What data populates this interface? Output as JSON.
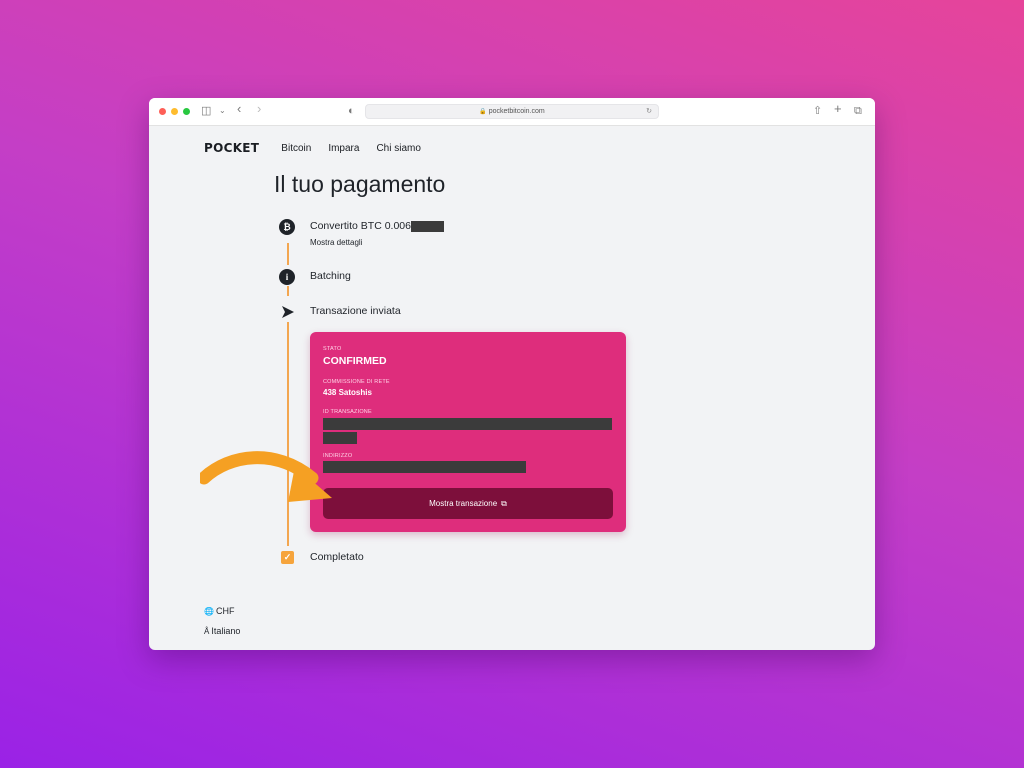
{
  "browser": {
    "url": "pocketbitcoin.com"
  },
  "nav": {
    "logo": "POCKET",
    "links": [
      "Bitcoin",
      "Impara",
      "Chi siamo"
    ]
  },
  "page": {
    "title": "Il tuo pagamento"
  },
  "steps": {
    "converted": {
      "label": "Convertito BTC 0.006",
      "sub": "Mostra dettagli",
      "icon": "bitcoin-icon"
    },
    "batching": {
      "label": "Batching",
      "icon": "info-icon"
    },
    "sent": {
      "label": "Transazione inviata",
      "icon": "send-icon"
    },
    "completed": {
      "label": "Completato",
      "icon": "check-icon"
    }
  },
  "card": {
    "status_label": "STATO",
    "status_value": "CONFIRMED",
    "fee_label": "COMMISSIONE DI RETE",
    "fee_value": "438 Satoshis",
    "txid_label": "ID TRANSAZIONE",
    "address_label": "INDIRIZZO",
    "button_label": "Mostra transazione",
    "accent": "#de2d7c",
    "button_color": "#7d0f3b"
  },
  "footer": {
    "currency": "CHF",
    "language": "Italiano"
  },
  "colors": {
    "timeline": "#f3a650",
    "annotation_arrow": "#f5a023"
  }
}
